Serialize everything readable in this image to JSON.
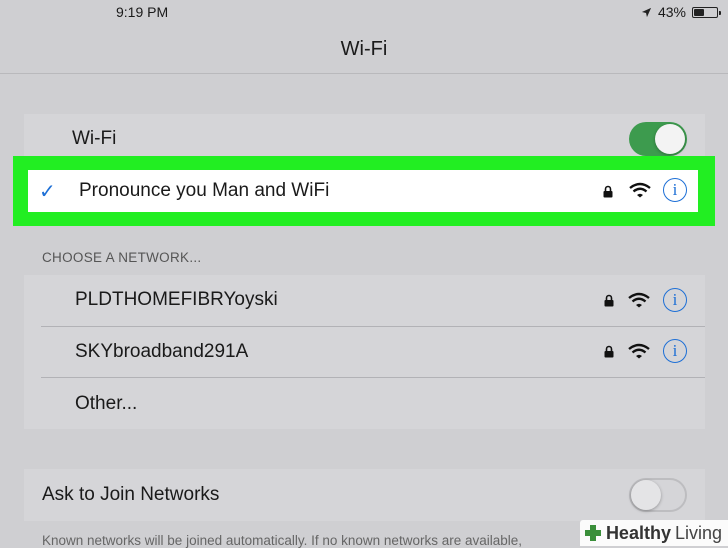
{
  "status_bar": {
    "time": "9:19 PM",
    "battery_percent": "43%"
  },
  "nav": {
    "title": "Wi-Fi"
  },
  "wifi_toggle": {
    "label": "Wi-Fi",
    "on": true
  },
  "current_network": {
    "name": "Pronounce you Man and WiFi",
    "checkmark": "✓"
  },
  "choose_header": "CHOOSE A NETWORK...",
  "networks": [
    {
      "name": "PLDTHOMEFIBRYoyski"
    },
    {
      "name": "SKYbroadband291A"
    }
  ],
  "other_label": "Other...",
  "ask_to_join": {
    "label": "Ask to Join Networks",
    "on": false
  },
  "footer": "Known networks will be joined automatically. If no known networks are available,",
  "watermark": {
    "brand": "Healthy",
    "suffix": "Living"
  },
  "colors": {
    "highlight": "#22ee22",
    "toggle_on": "#3d9b4e",
    "info_blue": "#1d6fd6"
  }
}
